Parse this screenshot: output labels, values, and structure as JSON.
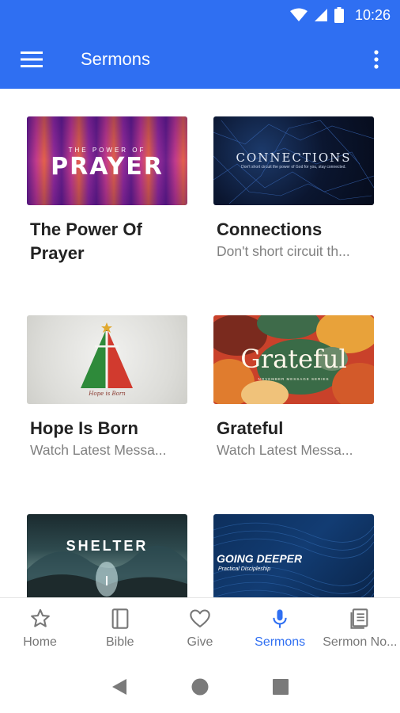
{
  "status_bar": {
    "time": "10:26"
  },
  "app_bar": {
    "title": "Sermons"
  },
  "sermons": [
    {
      "title": "The Power Of Prayer",
      "subtitle": "",
      "thumb_text": "PRAYER",
      "thumb_small": "THE POWER OF"
    },
    {
      "title": "Connections",
      "subtitle": "Don't short circuit th...",
      "thumb_text": "CONNECTIONS",
      "thumb_small": "Don't short circuit the power of God for you, stay connected."
    },
    {
      "title": "Hope Is Born",
      "subtitle": "Watch Latest Messa...",
      "thumb_text": "Hope is Born"
    },
    {
      "title": "Grateful",
      "subtitle": "Watch Latest Messa...",
      "thumb_text": "Grateful",
      "thumb_small": "NOVEMBER MESSAGE SERIES"
    },
    {
      "title": "",
      "subtitle": "",
      "thumb_text": "SHELTER"
    },
    {
      "title": "",
      "subtitle": "",
      "thumb_text": "GOING DEEPER",
      "thumb_small": "Practical Discipleship"
    }
  ],
  "bottom_nav": [
    {
      "label": "Home",
      "icon": "star-icon",
      "active": false
    },
    {
      "label": "Bible",
      "icon": "book-icon",
      "active": false
    },
    {
      "label": "Give",
      "icon": "heart-icon",
      "active": false
    },
    {
      "label": "Sermons",
      "icon": "microphone-icon",
      "active": true
    },
    {
      "label": "Sermon No...",
      "icon": "notes-icon",
      "active": false
    }
  ],
  "colors": {
    "primary": "#2f6ff2",
    "title_text": "#222222",
    "subtitle_text": "#808080",
    "nav_inactive": "#777777"
  }
}
